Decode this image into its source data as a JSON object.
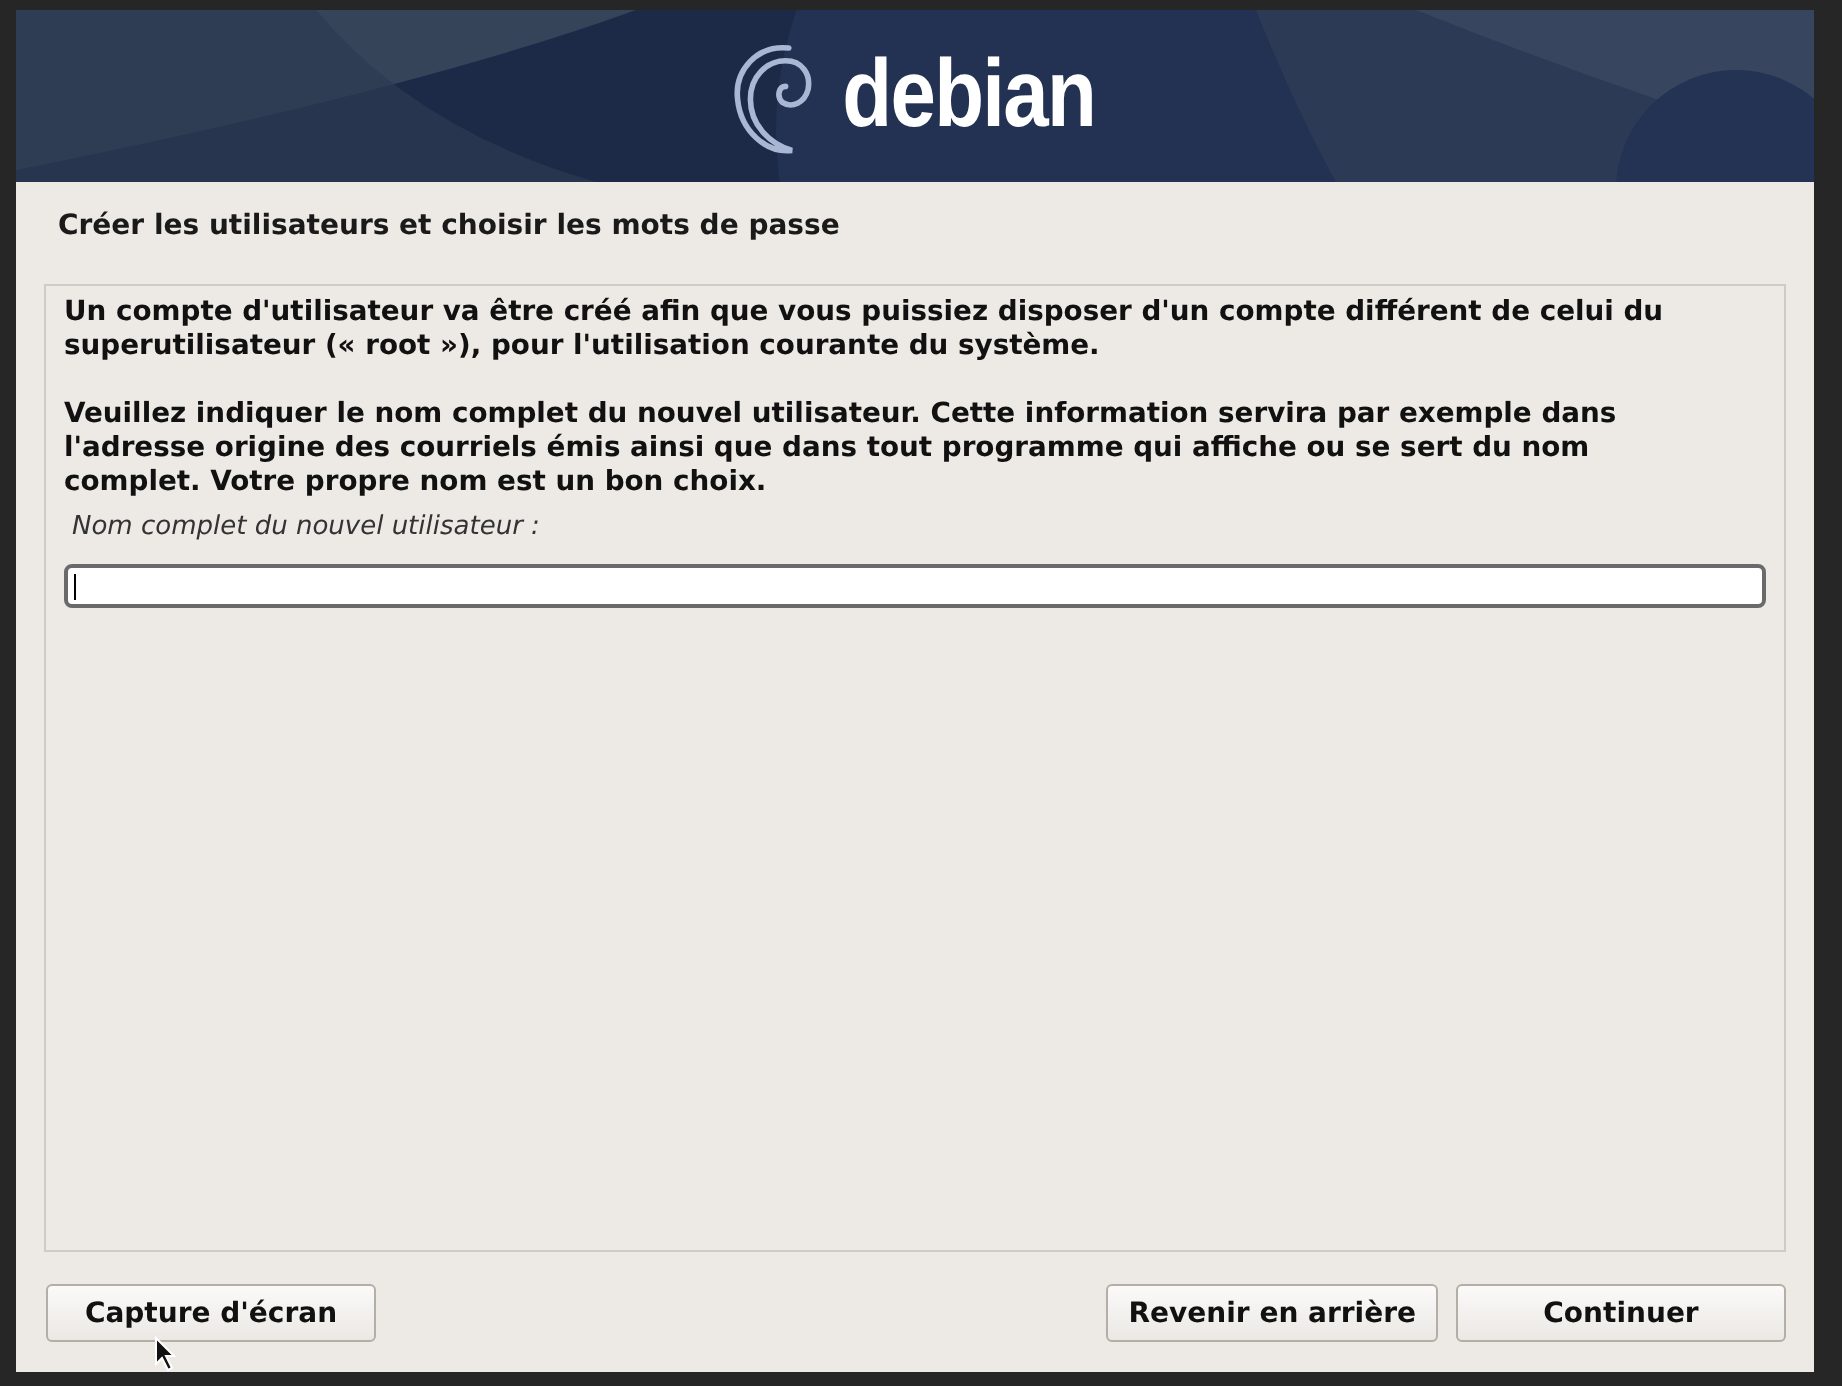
{
  "banner": {
    "logo_text": "debian"
  },
  "title": "Créer les utilisateurs et choisir les mots de passe",
  "paragraphs": [
    "Un compte d'utilisateur va être créé afin que vous puissiez disposer d'un compte différent de celui du superutilisateur (« root »), pour l'utilisation courante du système.",
    "Veuillez indiquer le nom complet du nouvel utilisateur. Cette information servira par exemple dans l'adresse origine des courriels émis ainsi que dans tout programme qui affiche ou se sert du nom complet. Votre propre nom est un bon choix."
  ],
  "field": {
    "label": "Nom complet du nouvel utilisateur :",
    "focused": true
  },
  "buttons": {
    "left": [
      "Capture d'écran"
    ],
    "right": [
      "Revenir en arrière",
      "Continuer"
    ]
  }
}
